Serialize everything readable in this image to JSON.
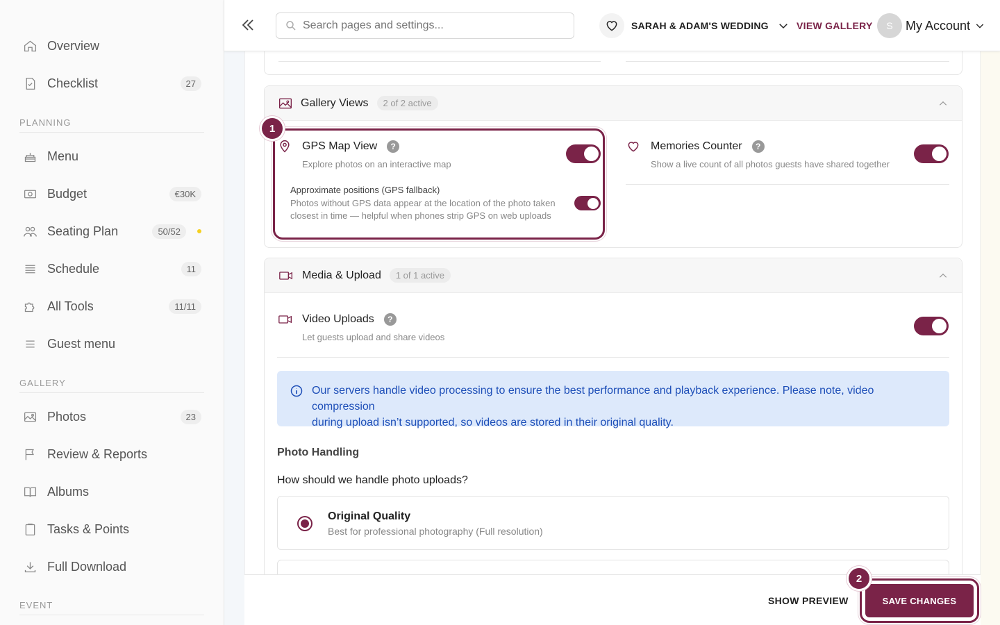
{
  "sidebar": {
    "items": [
      {
        "label": "Overview",
        "icon": "home-icon"
      },
      {
        "label": "Checklist",
        "icon": "checklist-icon",
        "badge": "27"
      },
      {
        "label": "Menu",
        "icon": "cake-icon"
      },
      {
        "label": "Budget",
        "icon": "money-icon",
        "badge": "€30K"
      },
      {
        "label": "Seating Plan",
        "icon": "people-icon",
        "badge": "50/52"
      },
      {
        "label": "Schedule",
        "icon": "schedule-icon",
        "badge": "11"
      },
      {
        "label": "All Tools",
        "icon": "puzzle-icon",
        "badge": "11/11"
      },
      {
        "label": "Guest menu",
        "icon": "menu-lines-icon"
      },
      {
        "label": "Photos",
        "icon": "image-icon",
        "badge": "23"
      },
      {
        "label": "Review & Reports",
        "icon": "flag-icon"
      },
      {
        "label": "Albums",
        "icon": "book-icon"
      },
      {
        "label": "Tasks & Points",
        "icon": "clipboard-icon"
      },
      {
        "label": "Full Download",
        "icon": "download-icon"
      }
    ],
    "sections": {
      "planning": "PLANNING",
      "gallery": "GALLERY",
      "event": "EVENT"
    }
  },
  "header": {
    "search_placeholder": "Search pages and settings...",
    "wedding_name": "SARAH & ADAM'S WEDDING",
    "view_gallery": "VIEW GALLERY",
    "avatar_initial": "S",
    "account_label": "My Account"
  },
  "gallery_views": {
    "title": "Gallery Views",
    "pill": "2 of 2 active",
    "gps": {
      "title": "GPS Map View",
      "desc": "Explore photos on an interactive map",
      "sub_title": "Approximate positions (GPS fallback)",
      "sub_desc_1": "Photos without GPS data appear at the location of the photo taken",
      "sub_desc_2": "closest in time — helpful when phones strip GPS on web uploads"
    },
    "memories": {
      "title": "Memories Counter",
      "desc": "Show a live count of all photos guests have shared together"
    }
  },
  "media_upload": {
    "title": "Media & Upload",
    "pill": "1 of 1 active",
    "video": {
      "title": "Video Uploads",
      "desc": "Let guests upload and share videos"
    },
    "info_line_1": "Our servers handle video processing to ensure the best performance and playback experience. Please note, video compression",
    "info_line_2": "during upload isn’t supported, so videos are stored in their original quality.",
    "photo_handling": "Photo Handling",
    "question": "How should we handle photo uploads?",
    "option": {
      "title": "Original Quality",
      "desc": "Best for professional photography (Full resolution)"
    }
  },
  "steps": {
    "one": "1",
    "two": "2"
  },
  "footer": {
    "show_preview": "SHOW PREVIEW",
    "save_changes": "SAVE CHANGES"
  },
  "colors": {
    "accent": "#7a2348",
    "info_bg": "#dde9fb",
    "info_text": "#1e4fb8"
  }
}
